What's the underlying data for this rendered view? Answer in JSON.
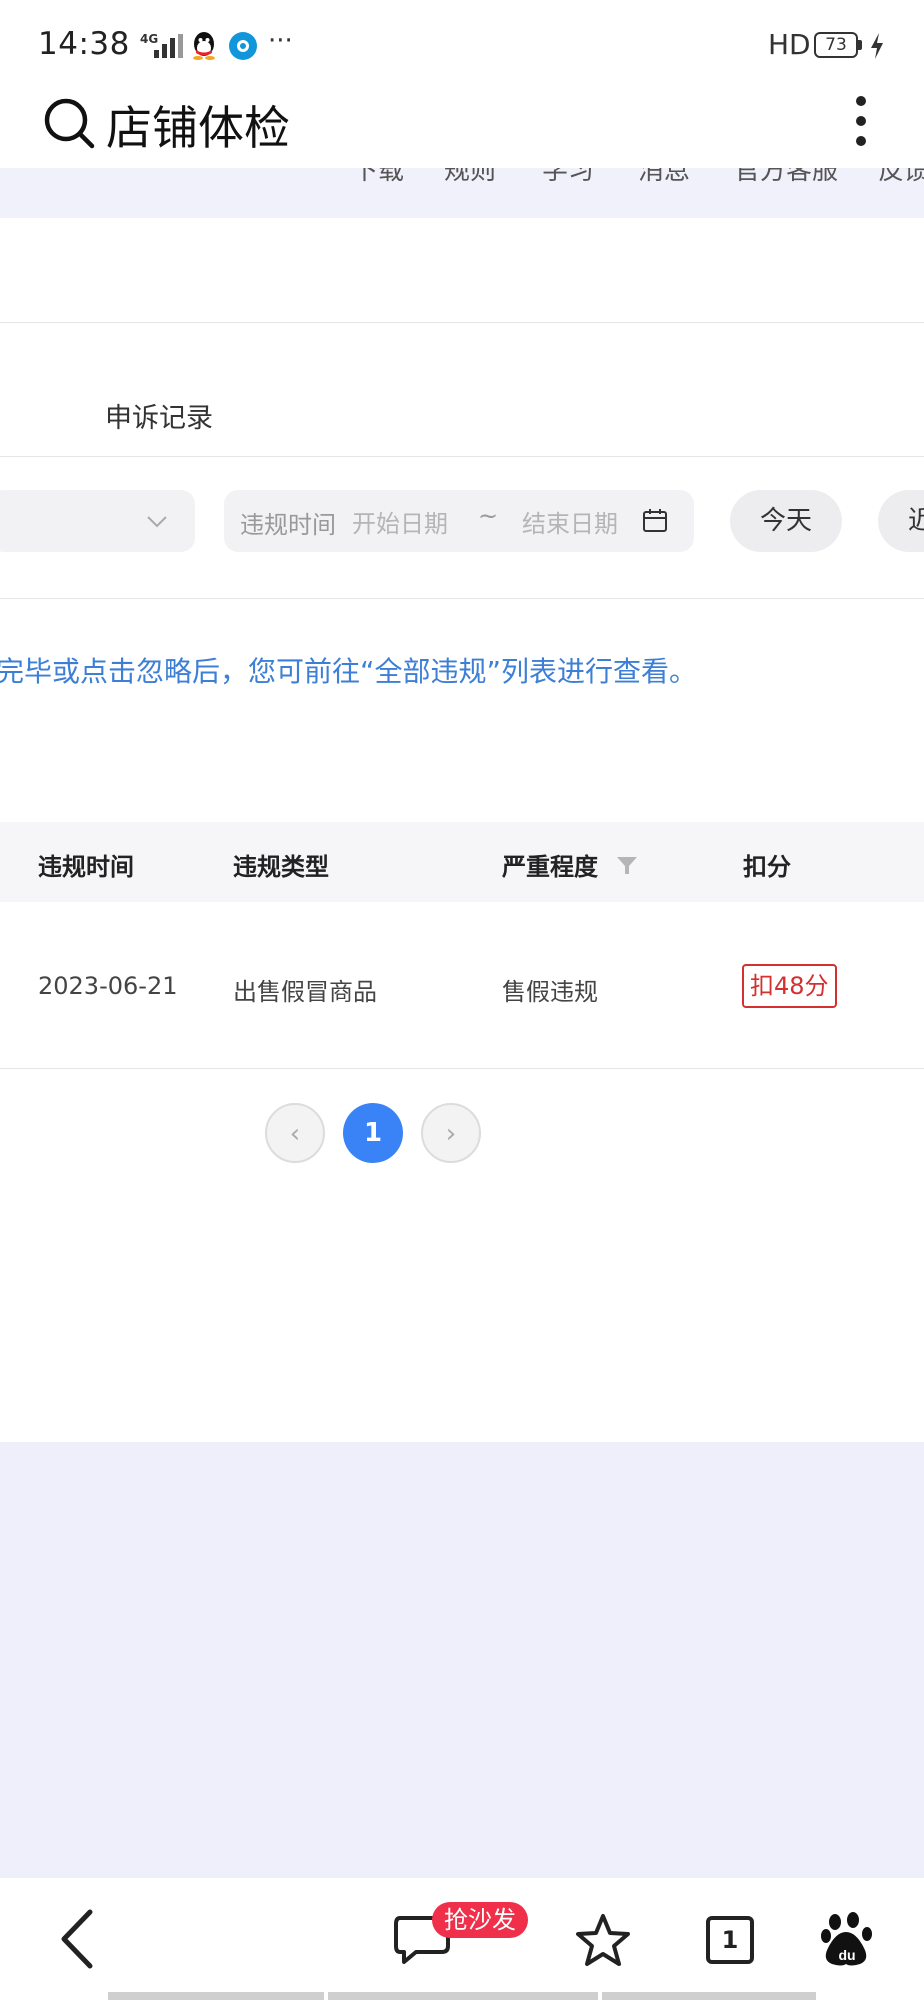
{
  "status_bar": {
    "time": "14:38",
    "network": "4G",
    "more": "···",
    "hd": "HD",
    "battery": "73"
  },
  "header": {
    "title": "店铺体检"
  },
  "nav_strip": {
    "items": [
      "下载",
      "规则",
      "学习",
      "消息",
      "官方客服",
      "反馈"
    ]
  },
  "tabs": {
    "appeal_records": "申诉记录"
  },
  "filters": {
    "date_label": "违规时间",
    "start_placeholder": "开始日期",
    "separator": "~",
    "end_placeholder": "结束日期",
    "today": "今天",
    "recent": "近"
  },
  "notice": "完毕或点击忽略后，您可前往“全部违规”列表进行查看。",
  "table": {
    "headers": [
      "违规时间",
      "违规类型",
      "严重程度",
      "扣分"
    ],
    "rows": [
      {
        "time": "2023-06-21",
        "type": "出售假冒商品",
        "severity": "售假违规",
        "score": "扣48分"
      }
    ]
  },
  "pagination": {
    "prev": "‹",
    "current": "1",
    "next": "›"
  },
  "bottom_bar": {
    "sofa_badge": "抢沙发",
    "tab_count": "1"
  },
  "colors": {
    "accent_blue": "#3a83f7",
    "notice_blue": "#3d7fd6",
    "danger_red": "#d43030",
    "badge_red": "#f0304a"
  }
}
